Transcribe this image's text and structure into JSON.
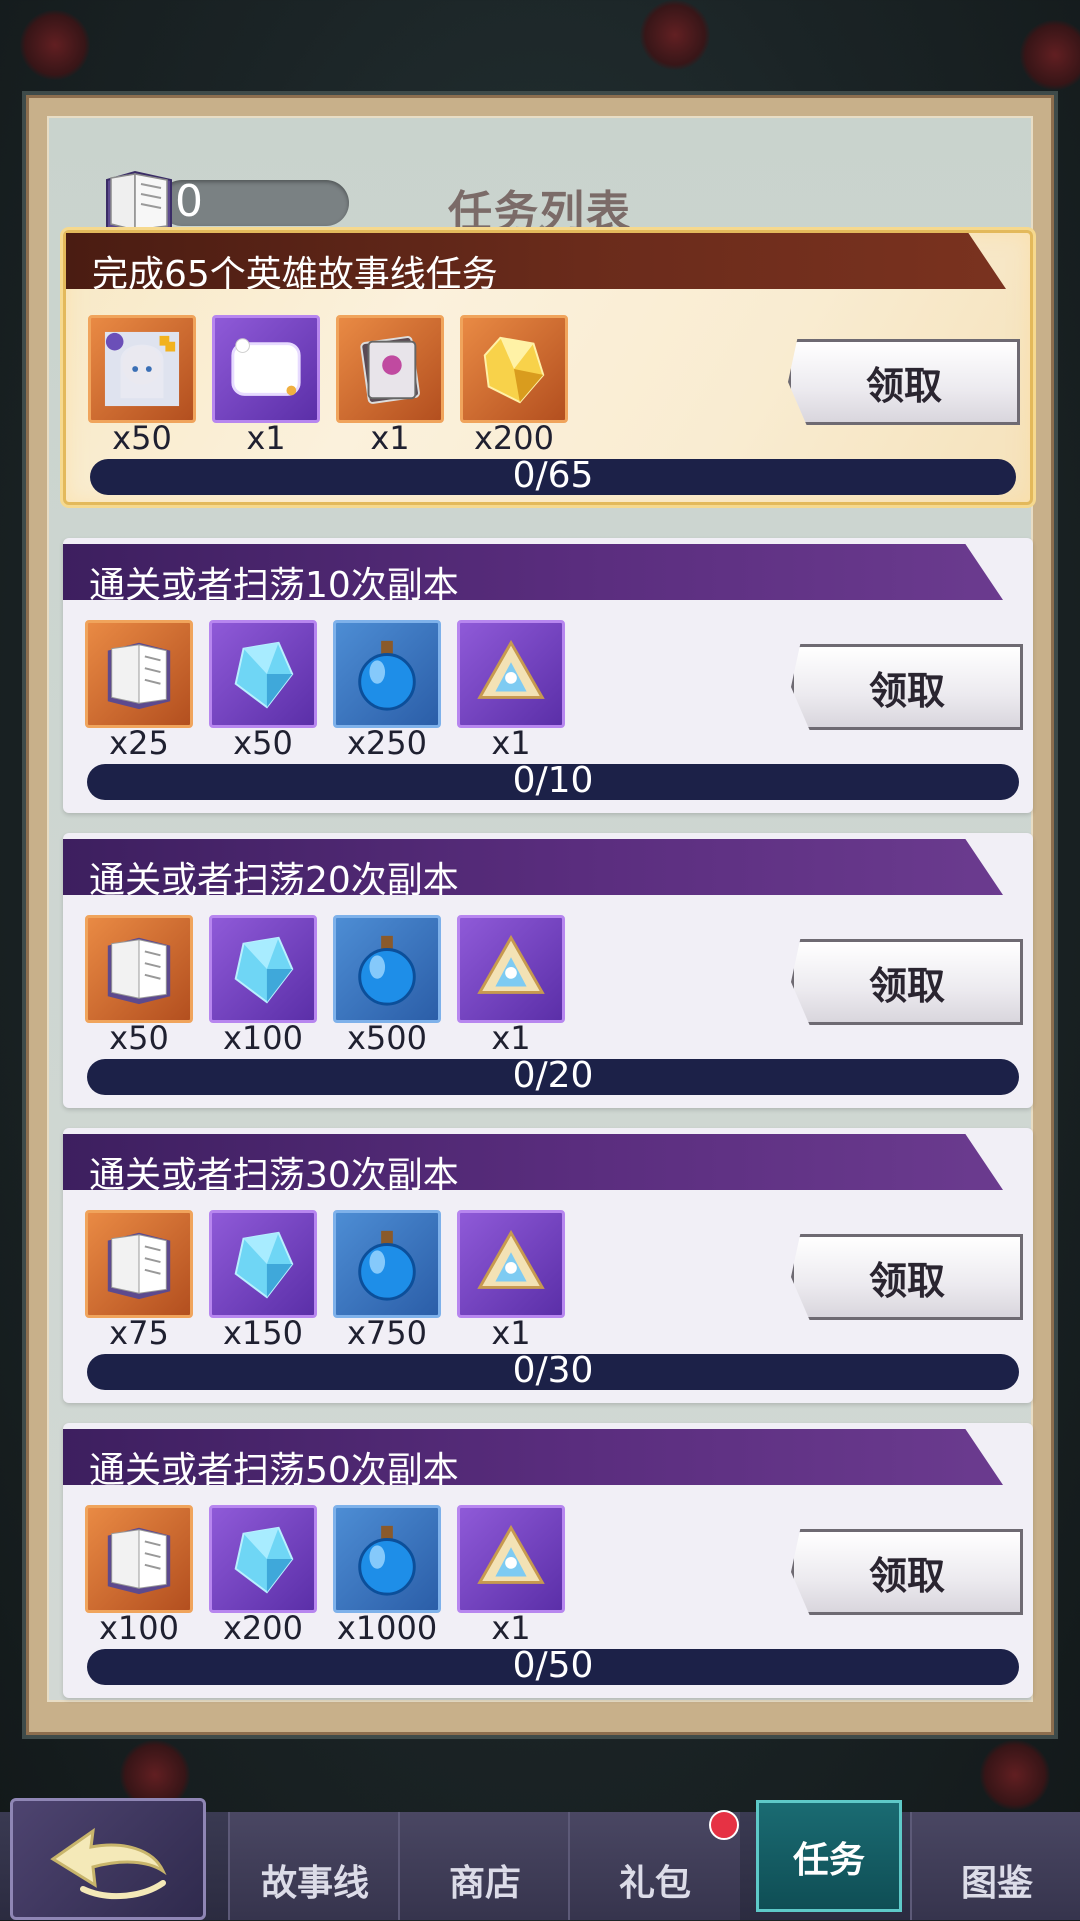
{
  "header": {
    "token_count": "0",
    "title": "任务列表",
    "token_icon": "task-book-icon"
  },
  "tasks": [
    {
      "title": "完成65个英雄故事线任务",
      "featured": true,
      "rewards": [
        {
          "icon": "hero-portrait-fragment-icon",
          "qty": "x50",
          "rarity": "orange"
        },
        {
          "icon": "chat-bubble-frame-icon",
          "qty": "x1",
          "rarity": "purple"
        },
        {
          "icon": "card-pack-icon",
          "qty": "x1",
          "rarity": "orange"
        },
        {
          "icon": "gold-crystal-icon",
          "qty": "x200",
          "rarity": "orange"
        }
      ],
      "claim_label": "领取",
      "progress_text": "0/65",
      "progress_value": 0
    },
    {
      "title": "通关或者扫荡10次副本",
      "rewards": [
        {
          "icon": "task-book-icon",
          "qty": "x25",
          "rarity": "orange"
        },
        {
          "icon": "blue-crystal-icon",
          "qty": "x50",
          "rarity": "purple"
        },
        {
          "icon": "blue-potion-icon",
          "qty": "x250",
          "rarity": "blue"
        },
        {
          "icon": "emblem-chest-icon",
          "qty": "x1",
          "rarity": "purple"
        }
      ],
      "claim_label": "领取",
      "progress_text": "0/10",
      "progress_value": 0
    },
    {
      "title": "通关或者扫荡20次副本",
      "rewards": [
        {
          "icon": "task-book-icon",
          "qty": "x50",
          "rarity": "orange"
        },
        {
          "icon": "blue-crystal-icon",
          "qty": "x100",
          "rarity": "purple"
        },
        {
          "icon": "blue-potion-icon",
          "qty": "x500",
          "rarity": "blue"
        },
        {
          "icon": "emblem-chest-icon",
          "qty": "x1",
          "rarity": "purple"
        }
      ],
      "claim_label": "领取",
      "progress_text": "0/20",
      "progress_value": 0
    },
    {
      "title": "通关或者扫荡30次副本",
      "rewards": [
        {
          "icon": "task-book-icon",
          "qty": "x75",
          "rarity": "orange"
        },
        {
          "icon": "blue-crystal-icon",
          "qty": "x150",
          "rarity": "purple"
        },
        {
          "icon": "blue-potion-icon",
          "qty": "x750",
          "rarity": "blue"
        },
        {
          "icon": "emblem-chest-icon",
          "qty": "x1",
          "rarity": "purple"
        }
      ],
      "claim_label": "领取",
      "progress_text": "0/30",
      "progress_value": 0
    },
    {
      "title": "通关或者扫荡50次副本",
      "rewards": [
        {
          "icon": "task-book-icon",
          "qty": "x100",
          "rarity": "orange"
        },
        {
          "icon": "blue-crystal-icon",
          "qty": "x200",
          "rarity": "purple"
        },
        {
          "icon": "blue-potion-icon",
          "qty": "x1000",
          "rarity": "blue"
        },
        {
          "icon": "emblem-chest-icon",
          "qty": "x1",
          "rarity": "purple"
        }
      ],
      "claim_label": "领取",
      "progress_text": "0/50",
      "progress_value": 0
    }
  ],
  "nav": {
    "back_icon": "back-arrow-icon",
    "tabs": [
      "故事线",
      "商店",
      "礼包",
      "任务",
      "图鉴"
    ],
    "active": "任务",
    "notification_on": "礼包"
  },
  "colors": {
    "banner_purple": "#5a2d7e",
    "banner_featured": "#6a2b1b",
    "progress_track": "#1c2148",
    "active_tab": "#1a6b72",
    "notification": "#e63244"
  }
}
